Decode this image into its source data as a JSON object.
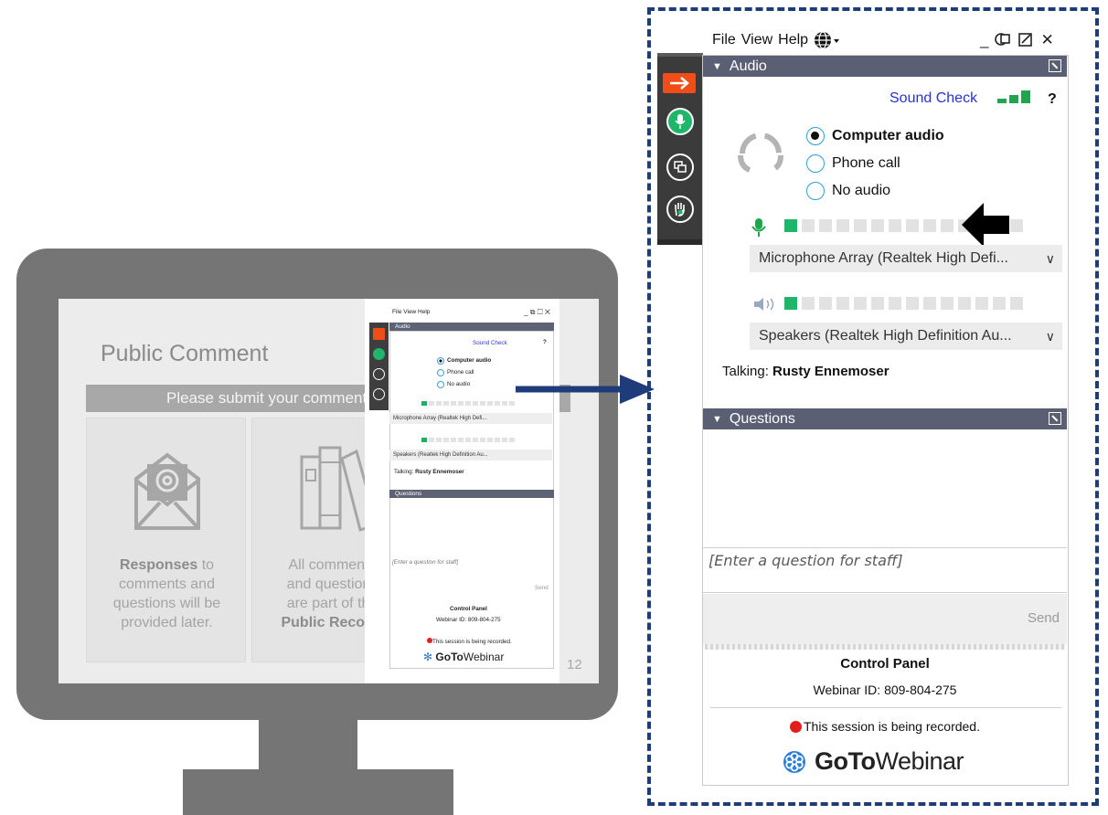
{
  "slide": {
    "title": "Public Comment",
    "banner": "Please submit your comments",
    "card1_bold": "Responses",
    "card1_text": " to\ncomments and\nquestions will be\nprovided later.",
    "card2_text": "All comments\nand questions\nare part of the\n",
    "card2_bold": "Public Record.",
    "page_number": "12"
  },
  "mini_panel": {
    "menu": "File  View  Help",
    "sound_check": "Sound Check",
    "help": "?",
    "audio_label": "Audio",
    "options": [
      "Computer audio",
      "Phone call",
      "No audio"
    ],
    "microphone": "Microphone Array (Realtek High Defi...",
    "speakers": "Speakers (Realtek High Definition Au...",
    "talking_label": "Talking:",
    "talking_name": "Rusty Ennemoser",
    "questions_label": "Questions",
    "question_placeholder": "[Enter a question for staff]",
    "send": "Send",
    "control_panel": "Control Panel",
    "webinar_id": "Webinar ID: 809-804-275",
    "recording": "This session is being recorded.",
    "brand_bold": "GoTo",
    "brand_rest": "Webinar"
  },
  "control_panel": {
    "menu": {
      "file": "File",
      "view": "View",
      "help": "Help"
    },
    "window_buttons": {
      "minimize": "_",
      "close": "✕"
    },
    "audio_section": {
      "label": "Audio",
      "collapse_glyph": "▼"
    },
    "sound_check": "Sound Check",
    "help": "?",
    "audio_options": [
      {
        "label": "Computer audio",
        "selected": true
      },
      {
        "label": "Phone call",
        "selected": false
      },
      {
        "label": "No audio",
        "selected": false
      }
    ],
    "mic_level": 1,
    "mic_device": "Microphone Array (Realtek High Defi...",
    "speaker_level": 1,
    "speaker_device": "Speakers (Realtek High Definition Au...",
    "dropdown_glyph": "∨",
    "talking_label": "Talking:",
    "talking_name": "Rusty Ennemoser",
    "questions_section": {
      "label": "Questions",
      "collapse_glyph": "▼"
    },
    "question_placeholder": "[Enter a question for staff]",
    "send_label": "Send",
    "footer": {
      "title": "Control Panel",
      "webinar_id": "Webinar ID: 809-804-275",
      "recording_notice": "This session is being recorded.",
      "brand_bold": "GoTo",
      "brand_rest": "Webinar"
    }
  },
  "colors": {
    "accent_orange": "#f04e16",
    "green": "#1fb56b",
    "link_blue": "#2731d6",
    "section_bar": "#5a5f73",
    "callout_border": "#1f3c7a",
    "record_red": "#e0201b",
    "monitor_gray": "#757575"
  },
  "icons": [
    "arrow-right-icon",
    "microphone-icon",
    "screens-icon",
    "raise-hand-icon",
    "headset-icon",
    "globe-icon",
    "speaker-icon",
    "gotowebinar-logo-icon"
  ]
}
